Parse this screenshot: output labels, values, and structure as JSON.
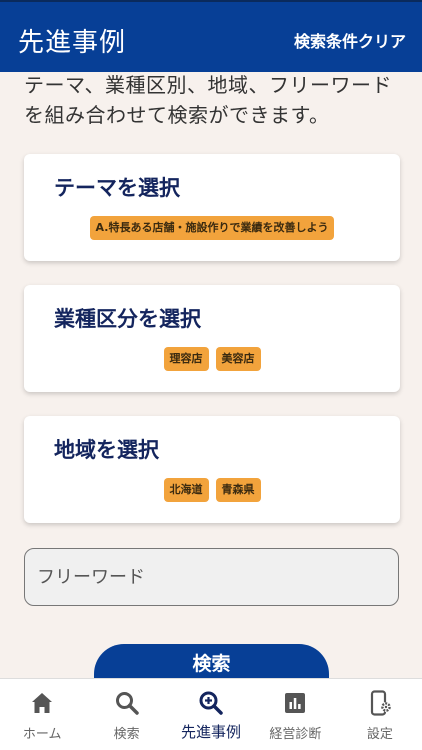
{
  "header": {
    "title": "先進事例",
    "clear_label": "検索条件クリア"
  },
  "intro": {
    "text": "テーマ、業種区別、地域、フリーワードを組み合わせて検索ができます。"
  },
  "sections": {
    "theme": {
      "title": "テーマを選択",
      "chips": [
        "A.特長ある店舗・施設作りで業績を改善しよう"
      ]
    },
    "industry": {
      "title": "業種区分を選択",
      "chips": [
        "理容店",
        "美容店"
      ]
    },
    "region": {
      "title": "地域を選択",
      "chips": [
        "北海道",
        "青森県"
      ]
    }
  },
  "freeword": {
    "placeholder": "フリーワード"
  },
  "search": {
    "label": "検索"
  },
  "tabbar": {
    "items": [
      {
        "label": "ホーム",
        "icon": "home-icon",
        "active": false
      },
      {
        "label": "検索",
        "icon": "search-icon",
        "active": false
      },
      {
        "label": "先進事例",
        "icon": "zoom-in-icon",
        "active": true
      },
      {
        "label": "経営診断",
        "icon": "bar-chart-icon",
        "active": false
      },
      {
        "label": "設定",
        "icon": "phone-settings-icon",
        "active": false
      }
    ]
  },
  "colors": {
    "primary": "#073f96",
    "navy_text": "#14255e",
    "chip": "#f2a33c",
    "background": "#f7f1ed"
  }
}
